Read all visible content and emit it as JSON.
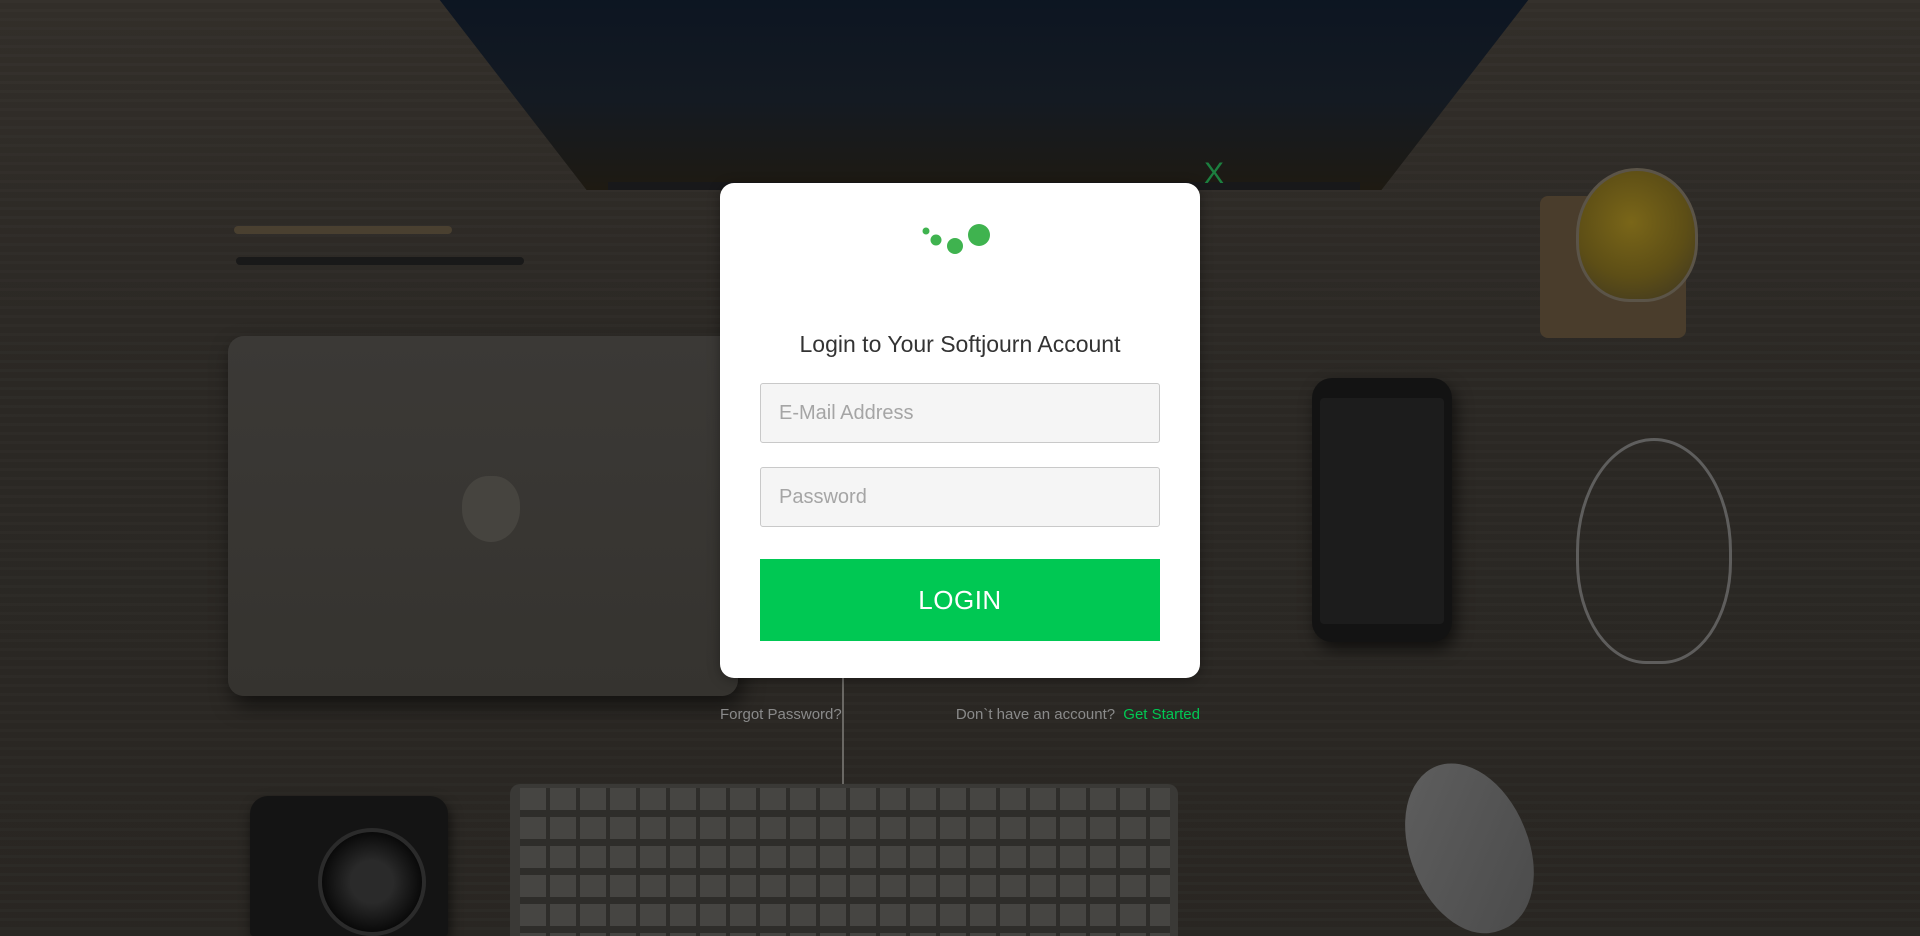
{
  "modal": {
    "title": "Login to Your Softjourn Account",
    "email_placeholder": "E-Mail Address",
    "email_value": "",
    "password_placeholder": "Password",
    "password_value": "",
    "login_label": "LOGIN",
    "close_label": "X"
  },
  "footer": {
    "forgot_label": "Forgot Password?",
    "no_account_text": "Don`t have an account?",
    "get_started_label": "Get Started"
  },
  "colors": {
    "accent": "#00c853",
    "logo_dots": "#3fb34f",
    "close": "#1c7f3f"
  },
  "icons": {
    "logo": "softjourn-dots-logo",
    "close": "close-icon"
  }
}
